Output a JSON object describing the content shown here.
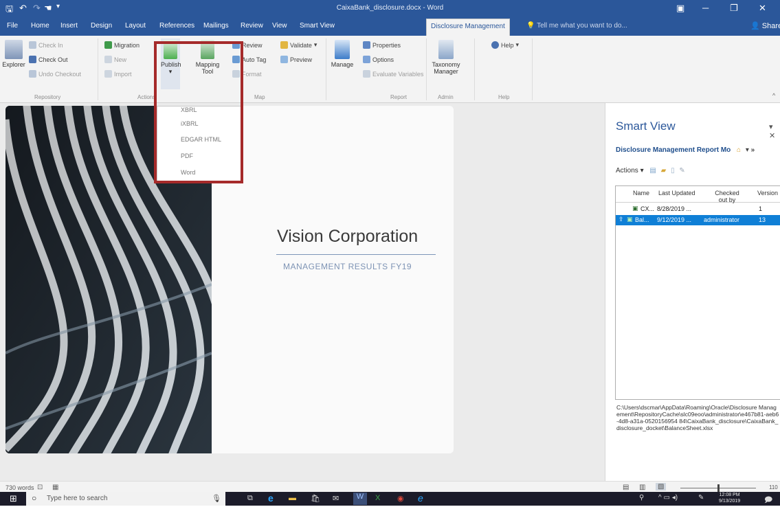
{
  "window": {
    "title": "CaixaBank_disclosure.docx - Word",
    "share_label": "Share"
  },
  "tabs": [
    "File",
    "Home",
    "Insert",
    "Design",
    "Layout",
    "References",
    "Mailings",
    "Review",
    "View",
    "Smart View",
    "Disclosure Management"
  ],
  "active_tab": "Disclosure Management",
  "tell_me_placeholder": "Tell me what you want to do...",
  "ribbon": {
    "repository": {
      "explorer": "Explorer",
      "check_in": "Check In",
      "check_out": "Check Out",
      "undo_checkout": "Undo Checkout",
      "group": "Repository"
    },
    "actions": {
      "migration": "Migration",
      "new": "New",
      "import": "Import",
      "group": "Actions"
    },
    "publish": {
      "label": "Publish",
      "arrow": "▾"
    },
    "mapping_tool": {
      "line1": "Mapping",
      "line2": "Tool"
    },
    "map": {
      "review": "Review",
      "auto_tag": "Auto Tag",
      "format": "Format",
      "validate": "Validate",
      "preview": "Preview",
      "group": "Map"
    },
    "report": {
      "manage": "Manage",
      "properties": "Properties",
      "options": "Options",
      "evaluate_variables": "Evaluate Variables",
      "group": "Report"
    },
    "admin": {
      "taxonomy_line1": "Taxonomy",
      "taxonomy_line2": "Manager",
      "group": "Admin"
    },
    "help": {
      "label": "Help",
      "group": "Help"
    }
  },
  "publish_menu": [
    "XBRL",
    "iXBRL",
    "EDGAR HTML",
    "PDF",
    "Word"
  ],
  "document": {
    "company": "Vision Corporation",
    "subtitle": "MANAGEMENT RESULTS  FY19"
  },
  "smart_view": {
    "title": "Smart View",
    "report_label": "Disclosure Management Report Mo",
    "actions_label": "Actions",
    "columns": [
      "Name",
      "Last Updated",
      "Checked out by",
      "Version"
    ],
    "rows": [
      {
        "name": "CX...",
        "updated": "8/28/2019 ...",
        "checked_out_by": "",
        "version": "1",
        "selected": false
      },
      {
        "name": "Bal...",
        "updated": "9/12/2019 ...",
        "checked_out_by": "administrator",
        "version": "13",
        "selected": true
      }
    ],
    "path": "C:\\Users\\dscmar\\AppData\\Roaming\\Oracle\\Disclosure Management\\RepositoryCache\\slc09eoo\\administrator\\e467b81-aeb6-4d8-a31a-0520156954 84\\CaixaBank_disclosure\\CaixaBank_disclosure_docket\\BalanceSheet.xlsx"
  },
  "status": {
    "words": "730 words",
    "zoom": "110"
  },
  "taskbar": {
    "search_placeholder": "Type here to search",
    "time": "12:08 PM",
    "date": "9/13/2019"
  },
  "colors": {
    "accent": "#2b579a",
    "highlight_box": "#a52a2a",
    "selection": "#0f7fd6"
  }
}
